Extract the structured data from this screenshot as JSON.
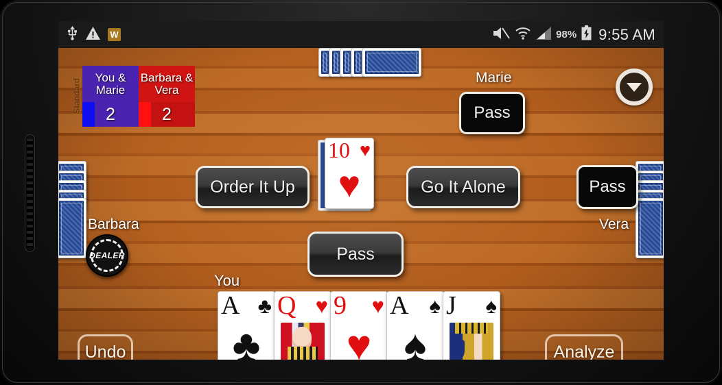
{
  "statusbar": {
    "icons": [
      "usb-icon",
      "warning-icon",
      "w-badge-icon",
      "mute-icon",
      "wifi-icon",
      "signal-icon",
      "battery-charging-icon"
    ],
    "w_badge": "W",
    "battery_percent": "98%",
    "time": "9:55 AM"
  },
  "scoreboard": {
    "mode_label": "Standard",
    "teams": [
      {
        "name": "You &\nMarie",
        "name_line1": "You &",
        "name_line2": "Marie",
        "score": "2",
        "color": "#4a24b0"
      },
      {
        "name": "Barbara &\nVera",
        "name_line1": "Barbara &",
        "name_line2": "Vera",
        "score": "2",
        "color": "#d01414"
      }
    ]
  },
  "players": {
    "top": {
      "name": "Marie",
      "action": "Pass",
      "cards_facedown": 5
    },
    "left": {
      "name": "Barbara",
      "is_dealer": true,
      "dealer_label": "DEALER",
      "cards_facedown": 5
    },
    "right": {
      "name": "Vera",
      "action": "Pass",
      "cards_facedown": 5
    },
    "bottom": {
      "name": "You"
    }
  },
  "turnup_card": {
    "rank": "10",
    "suit": "♥",
    "color": "red"
  },
  "hand": [
    {
      "rank": "A",
      "suit": "♣",
      "color": "black",
      "face": false
    },
    {
      "rank": "Q",
      "suit": "♥",
      "color": "red",
      "face": true,
      "art": "fc-queen"
    },
    {
      "rank": "9",
      "suit": "♥",
      "color": "red",
      "face": false
    },
    {
      "rank": "A",
      "suit": "♠",
      "color": "black",
      "face": false
    },
    {
      "rank": "J",
      "suit": "♠",
      "color": "black",
      "face": true,
      "art": "fc-jack"
    }
  ],
  "buttons": {
    "order_it_up": "Order It Up",
    "go_it_alone": "Go It Alone",
    "pass": "Pass",
    "undo": "Undo",
    "analyze": "Analyze"
  },
  "dropdown": {
    "icon": "chevron-down-circle-icon"
  }
}
